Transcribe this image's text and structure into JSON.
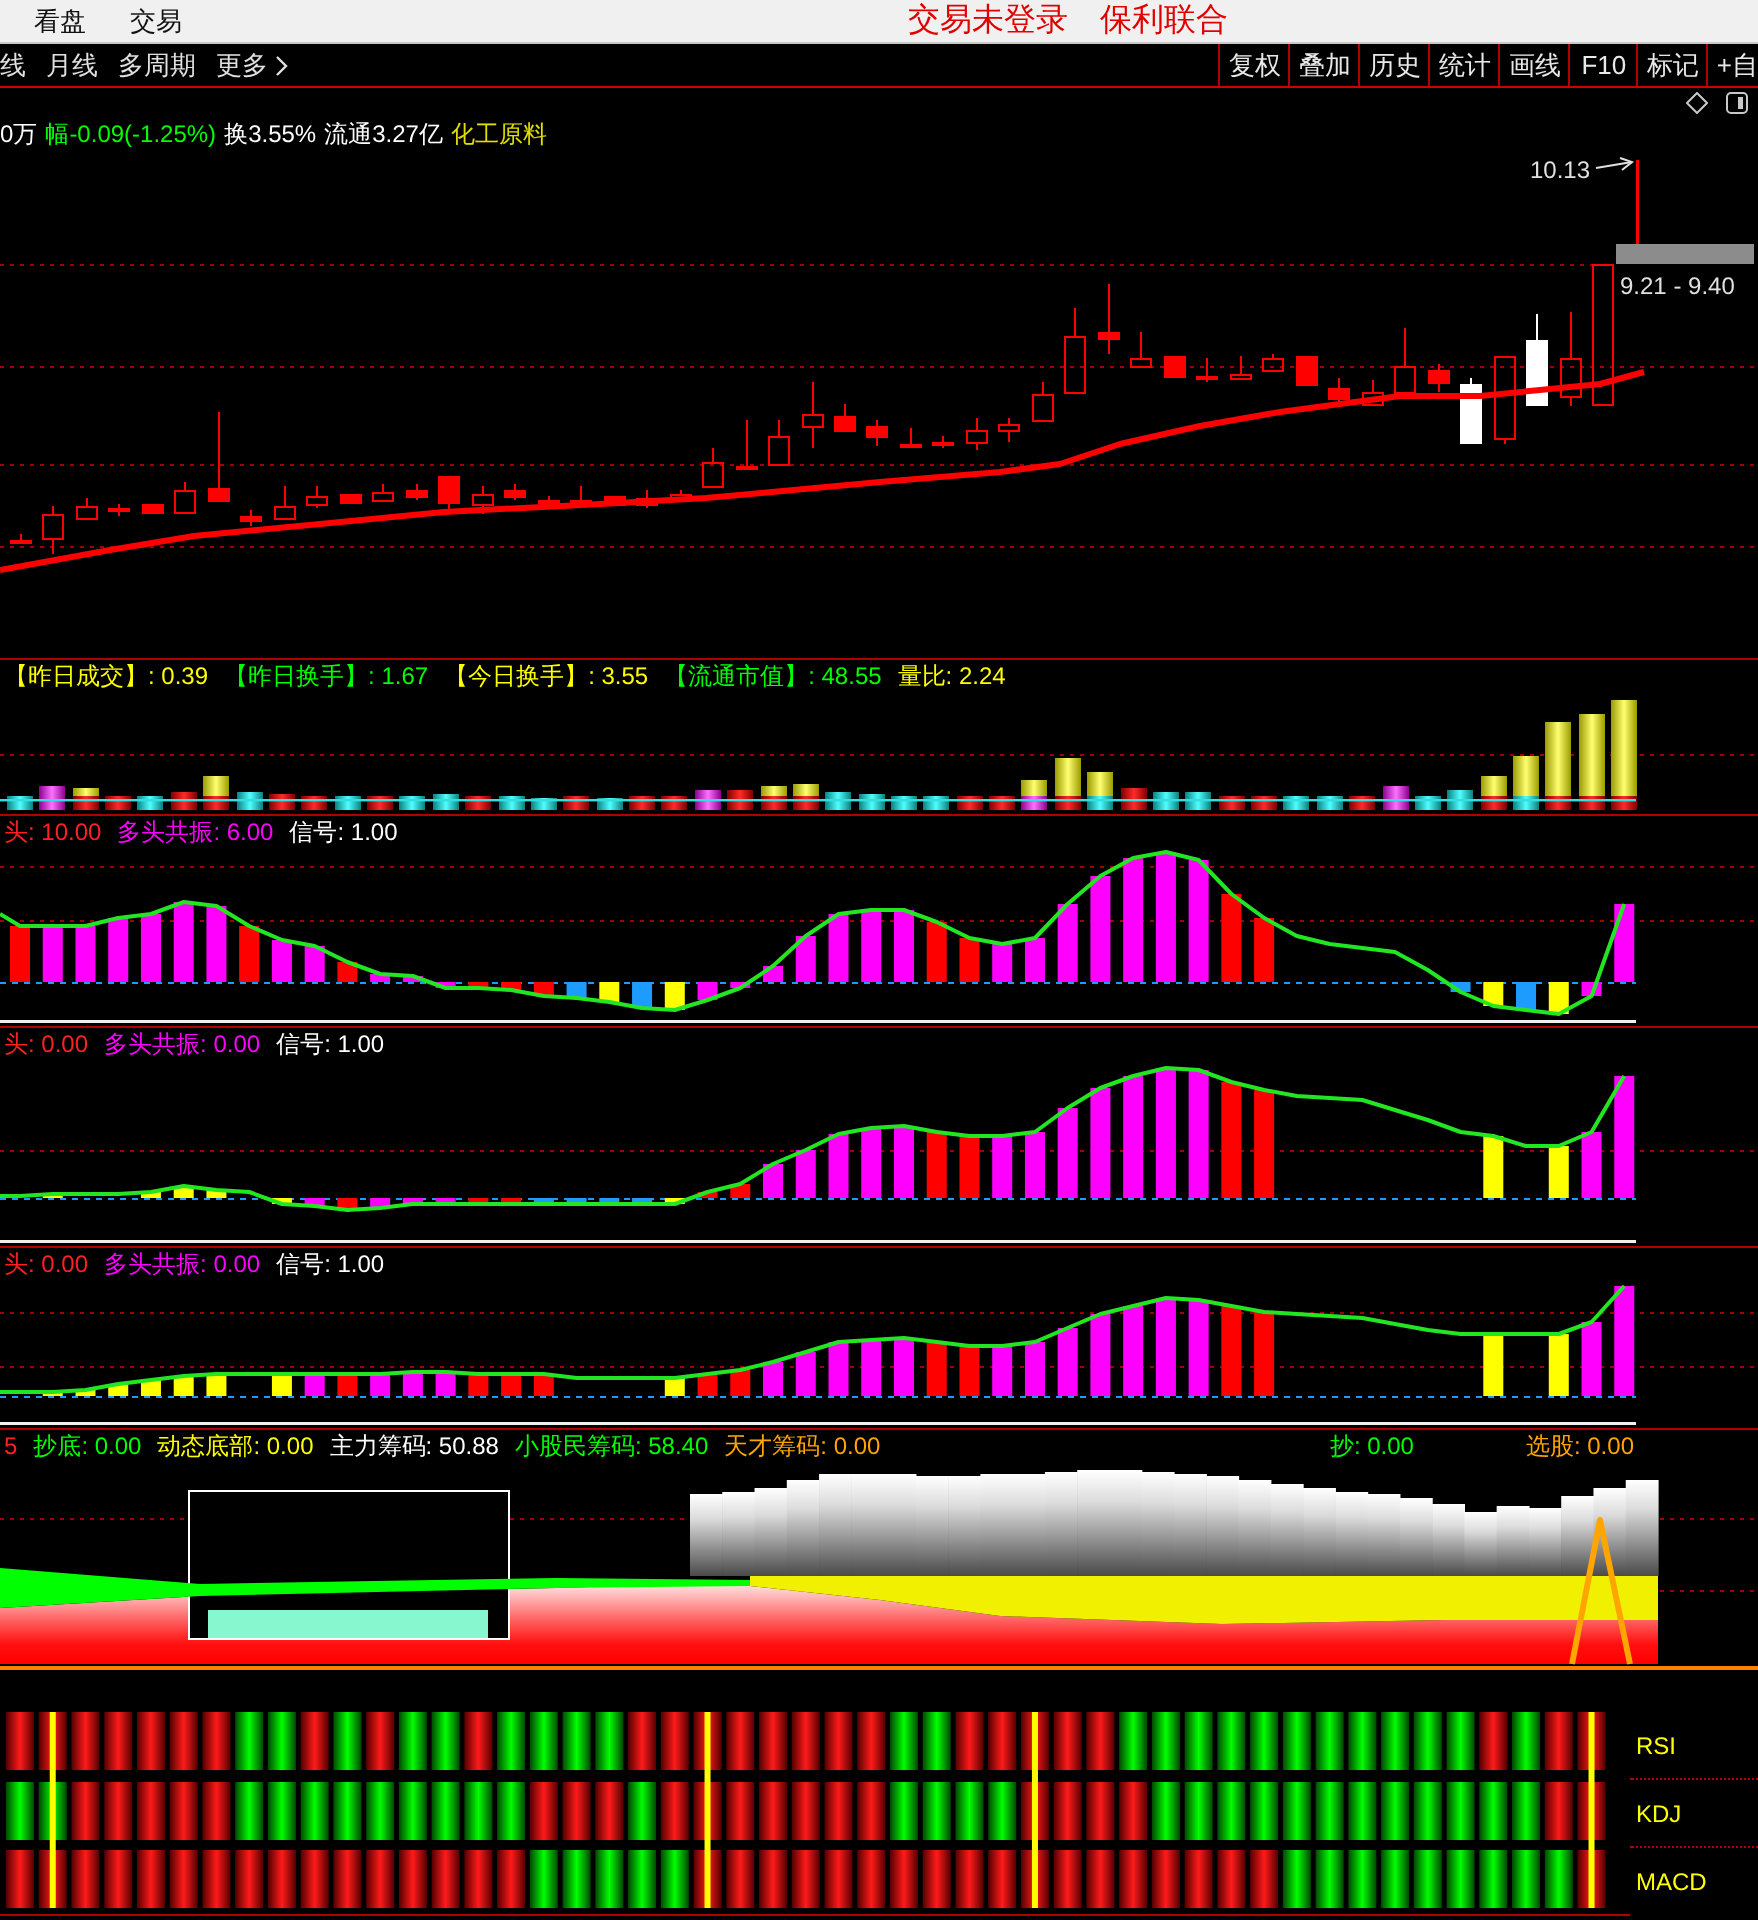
{
  "menu_bar": {
    "items": [
      "看盘",
      "交易"
    ],
    "status": [
      "交易未登录",
      "保利联合"
    ]
  },
  "toolbar": {
    "periods": [
      "线",
      "月线",
      "多周期"
    ],
    "more": "更多",
    "buttons": [
      "复权",
      "叠加",
      "历史",
      "统计",
      "画线",
      "F10",
      "标记",
      "+自"
    ]
  },
  "quote_line": [
    {
      "text": "0万",
      "color": "#ffffff"
    },
    {
      "text": "幅-0.09(-1.25%)",
      "color": "#00ff00"
    },
    {
      "text": "换3.55%",
      "color": "#ffffff"
    },
    {
      "text": "流通3.27亿",
      "color": "#ffffff"
    },
    {
      "text": "化工原料",
      "color": "#e0e000"
    }
  ],
  "price_chart": {
    "high_label": "10.13",
    "range_label": "9.21 - 9.40"
  },
  "volume_panel": {
    "legend": [
      {
        "text": "【昨日成交】: 0.39",
        "color": "#ffff00"
      },
      {
        "text": "【昨日换手】: 1.67",
        "color": "#00ff00"
      },
      {
        "text": "【今日换手】: 3.55",
        "color": "#ffff00"
      },
      {
        "text": "【流通市值】: 48.55",
        "color": "#00ff00"
      },
      {
        "text": "量比: 2.24",
        "color": "#ffff00"
      }
    ]
  },
  "signal_panels": [
    {
      "legend": [
        {
          "text": "头: 10.00",
          "color": "#ff2020"
        },
        {
          "text": "多头共振: 6.00",
          "color": "#ff00ff"
        },
        {
          "text": "信号: 1.00",
          "color": "#ffffff"
        }
      ]
    },
    {
      "legend": [
        {
          "text": "头: 0.00",
          "color": "#ff2020"
        },
        {
          "text": "多头共振: 0.00",
          "color": "#ff00ff"
        },
        {
          "text": "信号: 1.00",
          "color": "#ffffff"
        }
      ]
    },
    {
      "legend": [
        {
          "text": "头: 0.00",
          "color": "#ff2020"
        },
        {
          "text": "多头共振: 0.00",
          "color": "#ff00ff"
        },
        {
          "text": "信号: 1.00",
          "color": "#ffffff"
        }
      ]
    }
  ],
  "chip_panel": {
    "legend": [
      {
        "text": "5",
        "color": "#ff2020"
      },
      {
        "text": "抄底: 0.00",
        "color": "#00ff00"
      },
      {
        "text": "动态底部: 0.00",
        "color": "#ffff00"
      },
      {
        "text": "主力筹码: 50.88",
        "color": "#ffffff"
      },
      {
        "text": "小股民筹码: 58.40",
        "color": "#00ff00"
      },
      {
        "text": "天才筹码: 0.00",
        "color": "#ffa500"
      }
    ],
    "legend_right": [
      {
        "text": "抄: 0.00",
        "color": "#00ff00"
      },
      {
        "text": "选股: 0.00",
        "color": "#ffa500"
      }
    ]
  },
  "signal_strip": {
    "rows": [
      "RSI",
      "KDJ",
      "MACD"
    ]
  }
}
